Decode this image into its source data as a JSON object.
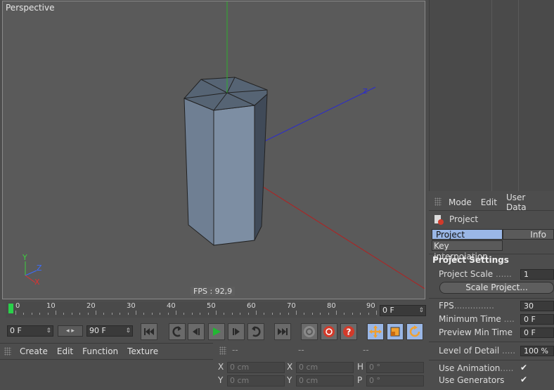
{
  "viewport": {
    "title": "Perspective",
    "fps": "FPS : 92,9",
    "axis_labels": {
      "y": "Y",
      "z": "Z",
      "x": "X"
    }
  },
  "timeline": {
    "ticks": [
      "0",
      "10",
      "20",
      "30",
      "40",
      "50",
      "60",
      "70",
      "80",
      "90"
    ],
    "current_frame": "0 F",
    "start_field": "0 F",
    "end_field": "90 F"
  },
  "transport": {
    "icons": [
      "go-to-start-icon",
      "key-prev-icon",
      "step-back-icon",
      "play-icon",
      "step-forward-icon",
      "key-next-icon",
      "go-to-end-icon",
      "record-disabled-icon",
      "record-icon",
      "help-icon",
      "move-icon",
      "scale-icon",
      "rotate-icon"
    ]
  },
  "material_menu": {
    "items": [
      "Create",
      "Edit",
      "Function",
      "Texture"
    ]
  },
  "coord_panel": {
    "headers": [
      "--",
      "--",
      "--"
    ],
    "rows": [
      {
        "l1": "X",
        "v1": "0 cm",
        "l2": "X",
        "v2": "0 cm",
        "l3": "H",
        "v3": "0 °"
      },
      {
        "l1": "Y",
        "v1": "0 cm",
        "l2": "Y",
        "v2": "0 cm",
        "l3": "P",
        "v3": "0 °"
      }
    ]
  },
  "attributes": {
    "menu": [
      "Mode",
      "Edit",
      "User Data"
    ],
    "object_name": "Project",
    "tabs": [
      "Project Settings",
      "Info",
      "Key Interpolation"
    ],
    "section_title": "Project Settings",
    "rows": [
      {
        "label": "Project Scale",
        "dots": " ......",
        "value": "1"
      },
      {
        "label": "FPS",
        "dots": "...............",
        "value": "30"
      },
      {
        "label": "Minimum Time",
        "dots": " ....",
        "value": "0 F"
      },
      {
        "label": "Preview Min Time",
        "dots": "",
        "value": "0 F"
      },
      {
        "label": "Level of Detail",
        "dots": " .....",
        "value": "100 %"
      },
      {
        "label": "Use Animation",
        "dots": ".....",
        "value": "✔"
      },
      {
        "label": "Use Generators",
        "dots": "",
        "value": "✔"
      }
    ],
    "scale_button": "Scale Project..."
  },
  "colors": {
    "accent_blue": "#9ab7e6",
    "playhead_green": "#29d14a",
    "tool_orange": "#f0a030"
  }
}
